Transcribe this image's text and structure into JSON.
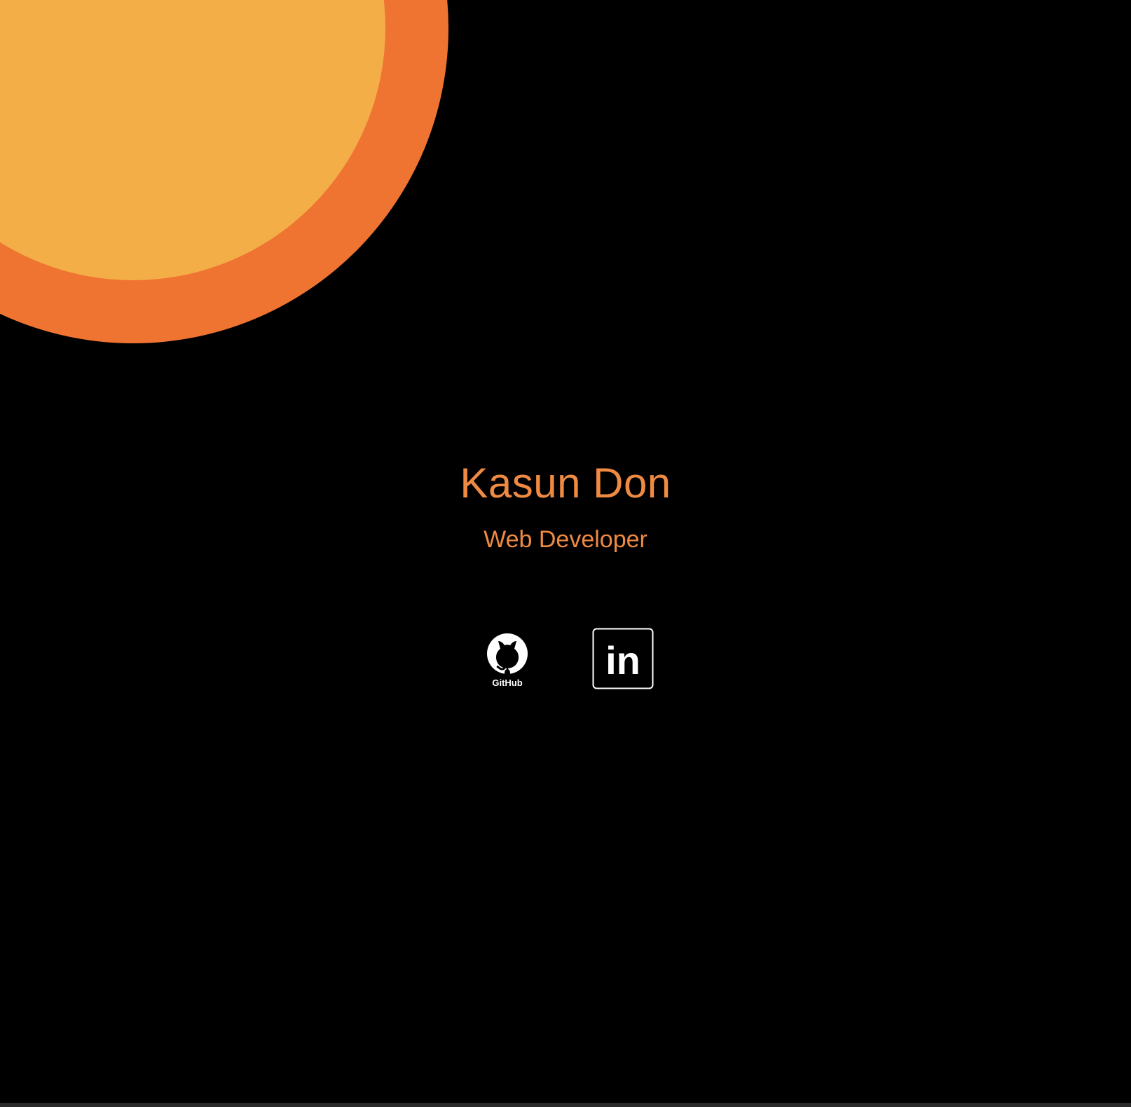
{
  "colors": {
    "background": "#000000",
    "accent": "#ef8a43",
    "sun_outer": "#ef7431",
    "sun_inner": "#f4ae47",
    "icon": "#ffffff"
  },
  "profile": {
    "name": "Kasun Don",
    "role": "Web Developer"
  },
  "socials": [
    {
      "icon": "github-icon",
      "label": "GitHub"
    },
    {
      "icon": "linkedin-icon",
      "label": "in"
    }
  ]
}
